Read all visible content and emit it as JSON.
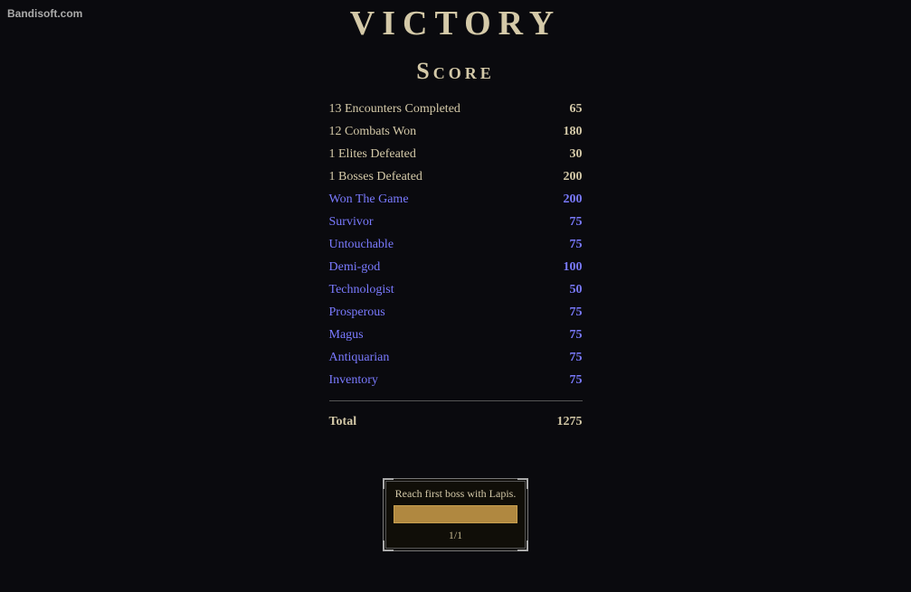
{
  "watermark": {
    "text": "Bandisoft.com"
  },
  "header": {
    "title": "VICTORY"
  },
  "score_section": {
    "heading": "Score",
    "rows": [
      {
        "label": "13 Encounters Completed",
        "value": "65",
        "bonus": false
      },
      {
        "label": "12 Combats Won",
        "value": "180",
        "bonus": false
      },
      {
        "label": "1 Elites Defeated",
        "value": "30",
        "bonus": false
      },
      {
        "label": "1 Bosses Defeated",
        "value": "200",
        "bonus": false
      },
      {
        "label": "Won The Game",
        "value": "200",
        "bonus": true
      },
      {
        "label": "Survivor",
        "value": "75",
        "bonus": true
      },
      {
        "label": "Untouchable",
        "value": "75",
        "bonus": true
      },
      {
        "label": "Demi-god",
        "value": "100",
        "bonus": true
      },
      {
        "label": "Technologist",
        "value": "50",
        "bonus": true
      },
      {
        "label": "Prosperous",
        "value": "75",
        "bonus": true
      },
      {
        "label": "Magus",
        "value": "75",
        "bonus": true
      },
      {
        "label": "Antiquarian",
        "value": "75",
        "bonus": true
      },
      {
        "label": "Inventory",
        "value": "75",
        "bonus": true
      }
    ],
    "total_label": "Total",
    "total_value": "1275"
  },
  "achievement": {
    "title_text": "Reach first boss with Lapis.",
    "fraction": "1/1"
  }
}
